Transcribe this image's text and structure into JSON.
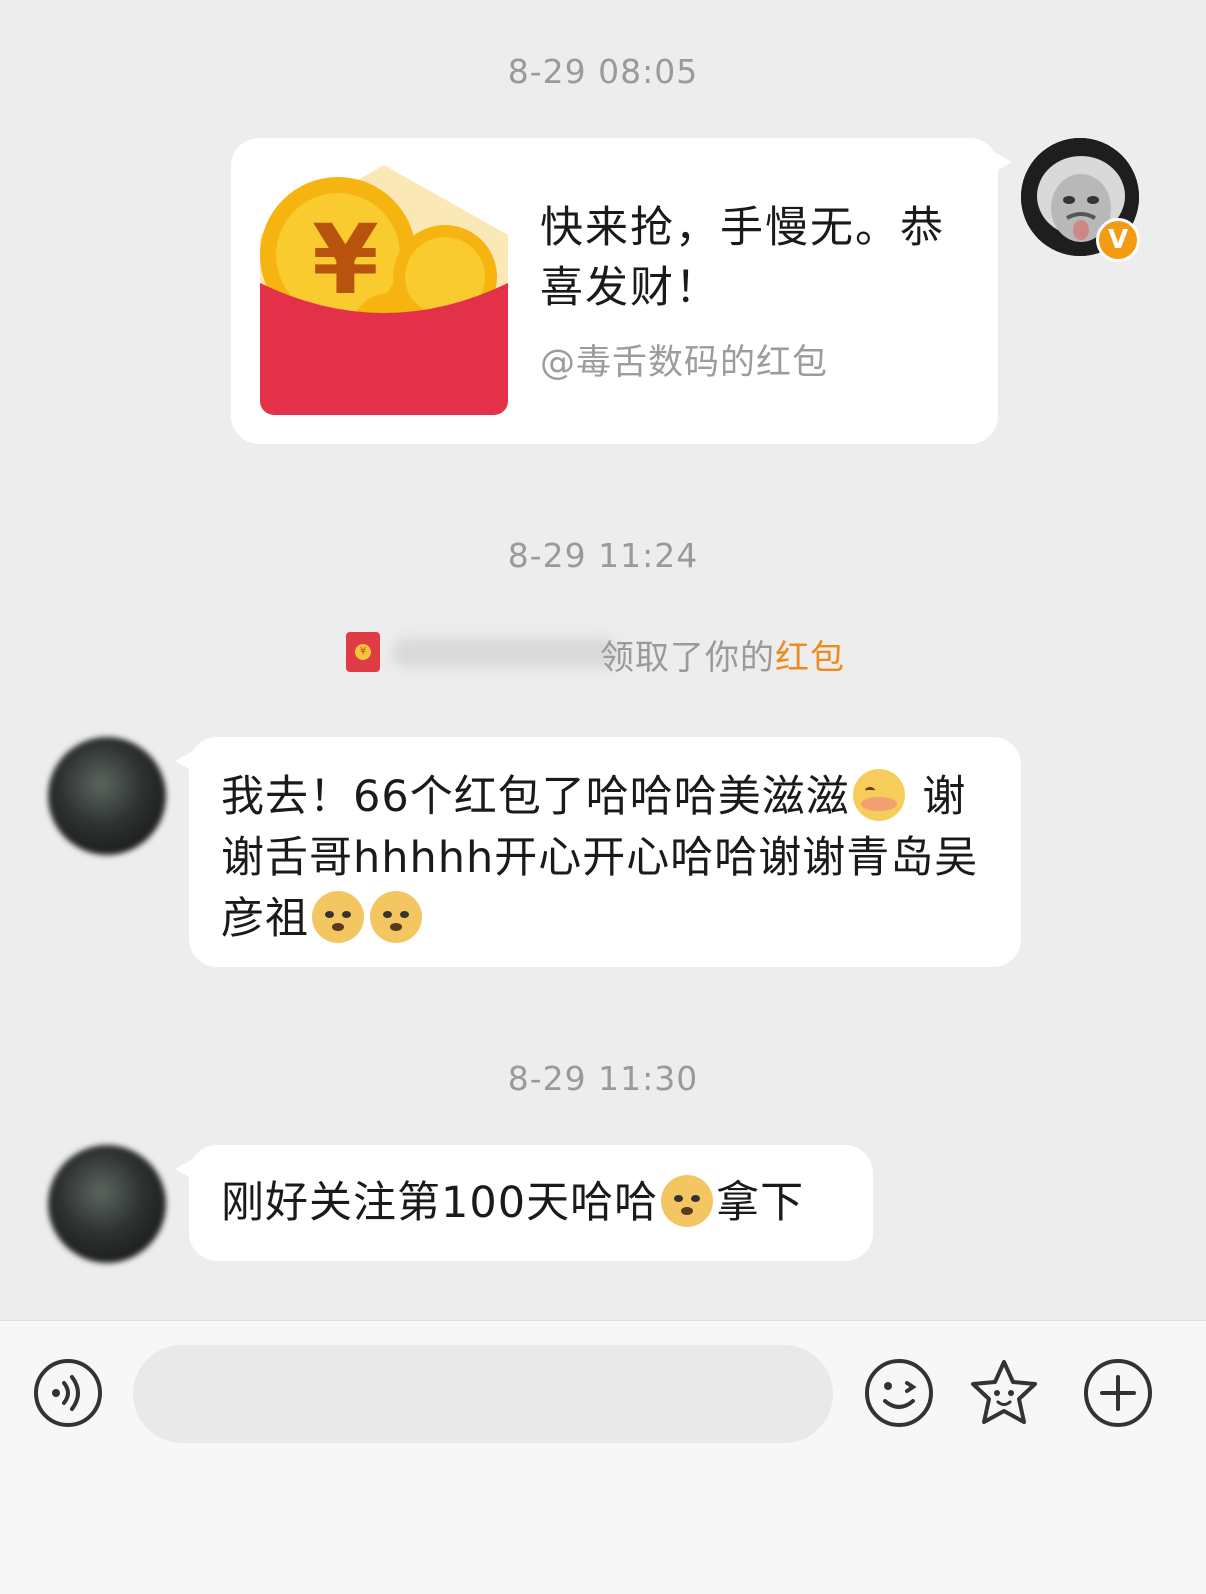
{
  "messages": {
    "ts1": "8-29 08:05",
    "red_packet": {
      "title": "快来抢，手慢无。恭喜发财！",
      "from": "@毒舌数码的红包",
      "sender_badge": "V"
    },
    "ts2": "8-29 11:24",
    "system": {
      "text": "领取了你的",
      "link": "红包"
    },
    "msg1": {
      "text1": "我去！66个红包了哈哈哈美滋滋",
      "text2": "谢谢舌哥hhhhh开心开心哈哈谢谢青岛吴彦祖"
    },
    "ts3": "8-29 11:30",
    "msg2": {
      "text1": "刚好关注第100天哈哈",
      "text2": "拿下"
    }
  },
  "input": {
    "value": "",
    "placeholder": ""
  },
  "toolbar": {
    "voice": "voice-icon",
    "emoji": "smile-icon",
    "sticker": "star-face-icon",
    "more": "plus-icon"
  },
  "colors": {
    "background": "#ededed",
    "bubble": "#ffffff",
    "red_packet": "#e3314a",
    "coin": "#f5b40f",
    "link": "#f08a1c",
    "verify_badge": "#f39c12"
  }
}
